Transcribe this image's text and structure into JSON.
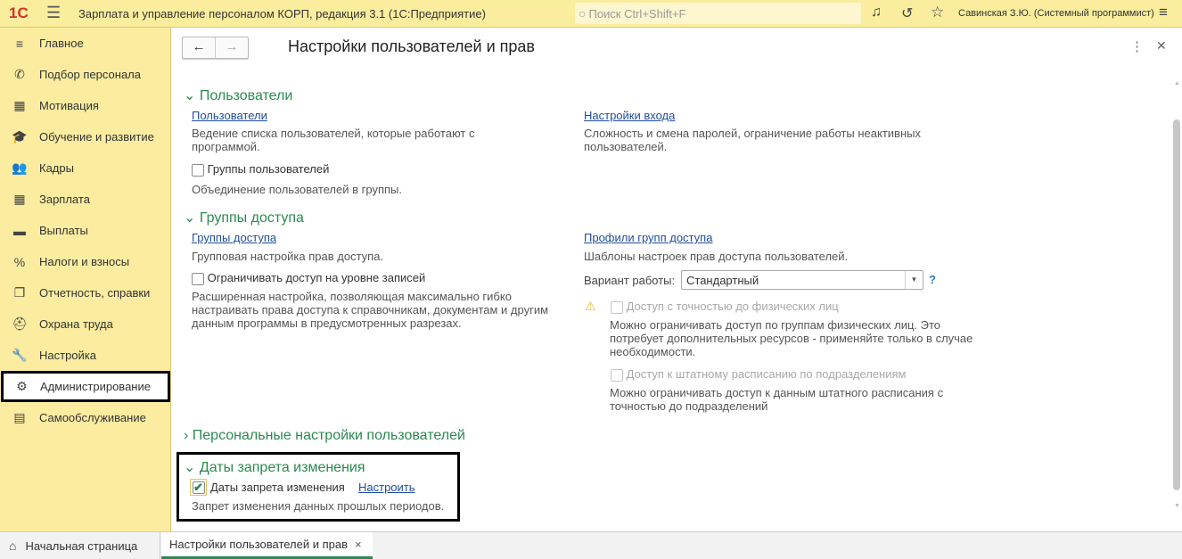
{
  "app": {
    "title": "Зарплата и управление персоналом КОРП, редакция 3.1  (1С:Предприятие)",
    "search_placeholder": "Поиск Ctrl+Shift+F",
    "user": "Савинская З.Ю. (Системный программист)",
    "brand_color": "#fbed9e"
  },
  "sidebar": {
    "items": [
      {
        "label": "Главное",
        "icon": "menu-lines-icon"
      },
      {
        "label": "Подбор персонала",
        "icon": "phone-icon"
      },
      {
        "label": "Мотивация",
        "icon": "gift-icon"
      },
      {
        "label": "Обучение и развитие",
        "icon": "graduation-cap-icon"
      },
      {
        "label": "Кадры",
        "icon": "people-icon"
      },
      {
        "label": "Зарплата",
        "icon": "calculator-icon"
      },
      {
        "label": "Выплаты",
        "icon": "wallet-icon"
      },
      {
        "label": "Налоги и взносы",
        "icon": "percent-icon"
      },
      {
        "label": "Отчетность, справки",
        "icon": "documents-icon"
      },
      {
        "label": "Охрана труда",
        "icon": "helmet-icon"
      },
      {
        "label": "Настройка",
        "icon": "wrench-icon"
      },
      {
        "label": "Администрирование",
        "icon": "gear-icon",
        "active": true
      },
      {
        "label": "Самообслуживание",
        "icon": "id-card-icon"
      }
    ]
  },
  "page": {
    "title": "Настройки пользователей и прав"
  },
  "sections": {
    "users": {
      "title": "Пользователи",
      "link1": "Пользователи",
      "desc1": "Ведение списка пользователей, которые работают с программой.",
      "cb_groups": "Группы пользователей",
      "cb_groups_checked": false,
      "desc_groups": "Объединение пользователей в группы.",
      "link2": "Настройки входа",
      "desc2": "Сложность и смена паролей, ограничение работы неактивных пользователей."
    },
    "access": {
      "title": "Группы доступа",
      "link1": "Группы доступа",
      "desc1": "Групповая настройка прав доступа.",
      "cb_records": "Ограничивать доступ на уровне записей",
      "cb_records_checked": false,
      "desc_records": "Расширенная настройка, позволяющая максимально гибко настраивать права доступа к справочникам, документам и другим данным программы в предусмотренных разрезах.",
      "link2": "Профили групп доступа",
      "desc2": "Шаблоны настроек прав доступа пользователей.",
      "variant_label": "Вариант работы:",
      "variant_value": "Стандартный",
      "help": "?",
      "cb_persons": "Доступ с точностью до физических лиц",
      "desc_persons": "Можно ограничивать доступ по группам физических лиц. Это потребует дополнительных ресурсов - применяйте только в случае необходимости.",
      "cb_staff": "Доступ к штатному расписанию по подразделениям",
      "desc_staff": "Можно ограничивать доступ к данным штатного расписания с точностью до подразделений"
    },
    "personal": {
      "title": "Персональные настройки пользователей"
    },
    "dates": {
      "title": "Даты запрета изменения",
      "cb": "Даты запрета изменения",
      "cb_checked": true,
      "link": "Настроить",
      "desc": "Запрет изменения данных прошлых периодов."
    }
  },
  "tabs": [
    {
      "label": "Начальная страница"
    },
    {
      "label": "Настройки пользователей и прав",
      "active": true,
      "close": "×"
    }
  ]
}
